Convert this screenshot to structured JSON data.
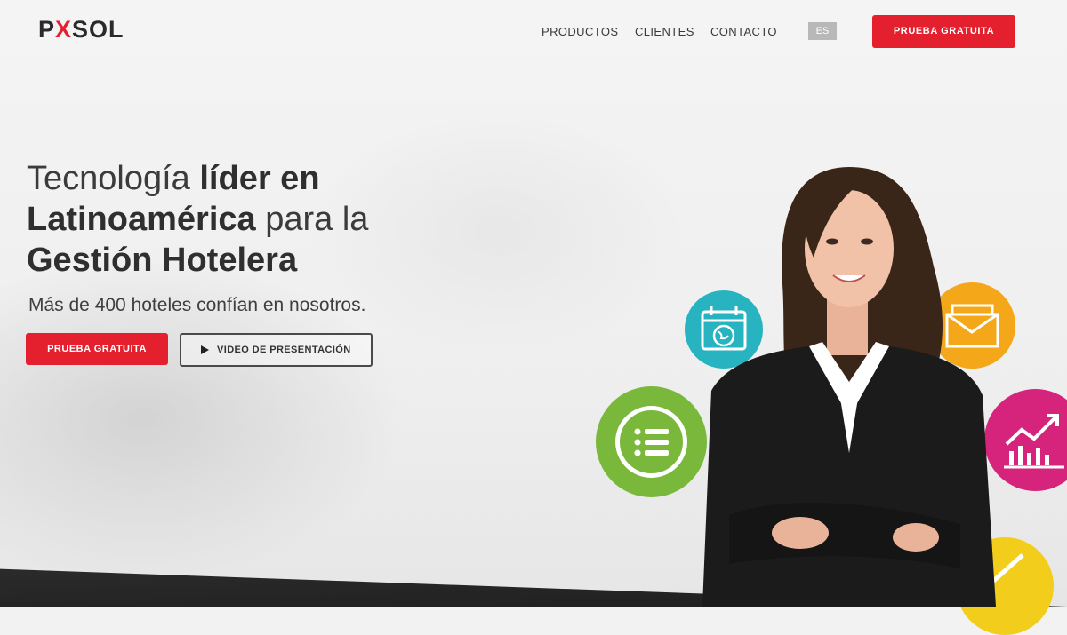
{
  "header": {
    "logo_prefix": "P",
    "logo_x": "X",
    "logo_suffix": "SOL",
    "nav": {
      "productos": "PRODUCTOS",
      "clientes": "CLIENTES",
      "contacto": "CONTACTO"
    },
    "language": "ES",
    "cta": "PRUEBA GRATUITA"
  },
  "hero": {
    "headline_1": "Tecnología ",
    "headline_2": "líder en",
    "headline_3": "Latinoamérica",
    "headline_4": " para la",
    "headline_5": "Gestión Hotelera",
    "subheadline": "Más de 400 hoteles confían en nosotros.",
    "primary_button": "PRUEBA GRATUITA",
    "secondary_button": "VIDEO DE PRESENTACIÓN"
  },
  "icons": [
    "calendar-globe-icon",
    "mail-icon",
    "list-icon",
    "growth-chart-icon",
    "edit-icon"
  ],
  "colors": {
    "brand_red": "#e5202e",
    "teal": "#27b3bf",
    "orange": "#f5a71a",
    "green": "#7ab83b",
    "magenta": "#d6247d",
    "yellow": "#f2cd1c"
  }
}
